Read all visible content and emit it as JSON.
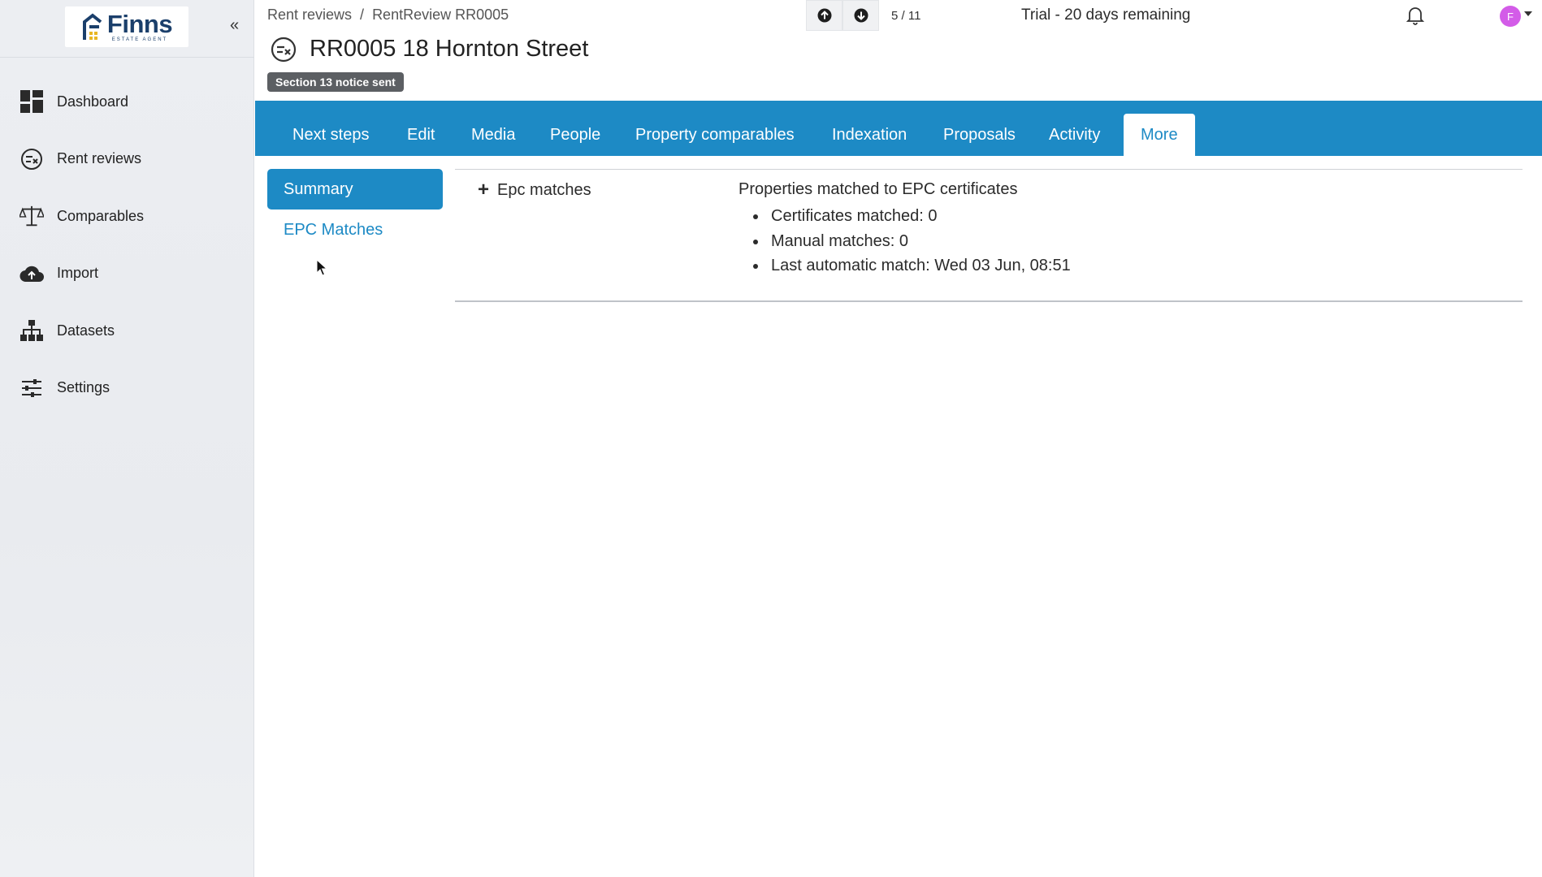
{
  "sidebar": {
    "logo": {
      "text": "Finns",
      "subtext": "ESTATE AGENT"
    },
    "collapse_label": "«",
    "items": [
      {
        "label": "Dashboard",
        "icon": "dashboard-icon"
      },
      {
        "label": "Rent reviews",
        "icon": "rent-review-icon"
      },
      {
        "label": "Comparables",
        "icon": "scales-icon"
      },
      {
        "label": "Import",
        "icon": "cloud-upload-icon"
      },
      {
        "label": "Datasets",
        "icon": "hierarchy-icon"
      },
      {
        "label": "Settings",
        "icon": "sliders-icon"
      }
    ]
  },
  "header": {
    "breadcrumb": {
      "root": "Rent reviews",
      "separator": "/",
      "current": "RentReview RR0005"
    },
    "pager": {
      "position": "5 / 11"
    },
    "trial_text": "Trial - 20 days remaining",
    "avatar_initial": "F"
  },
  "record": {
    "title": "RR0005 18 Hornton Street",
    "status_badge": "Section 13 notice sent"
  },
  "tabs": [
    {
      "label": "Next steps"
    },
    {
      "label": "Edit"
    },
    {
      "label": "Media"
    },
    {
      "label": "People"
    },
    {
      "label": "Property comparables"
    },
    {
      "label": "Indexation"
    },
    {
      "label": "Proposals"
    },
    {
      "label": "Activity"
    },
    {
      "label": "More",
      "active": true
    }
  ],
  "subnav": {
    "active": "Summary",
    "link": "EPC Matches"
  },
  "epc": {
    "section_label": "Epc matches",
    "heading": "Properties matched to EPC certificates",
    "items": [
      "Certificates matched: 0",
      "Manual matches: 0",
      "Last automatic match: Wed 03 Jun, 08:51"
    ]
  },
  "colors": {
    "accent": "#1d8ac5",
    "badge": "#5c5f63",
    "avatar": "#d35ce8",
    "logo": "#1b3f6b"
  }
}
